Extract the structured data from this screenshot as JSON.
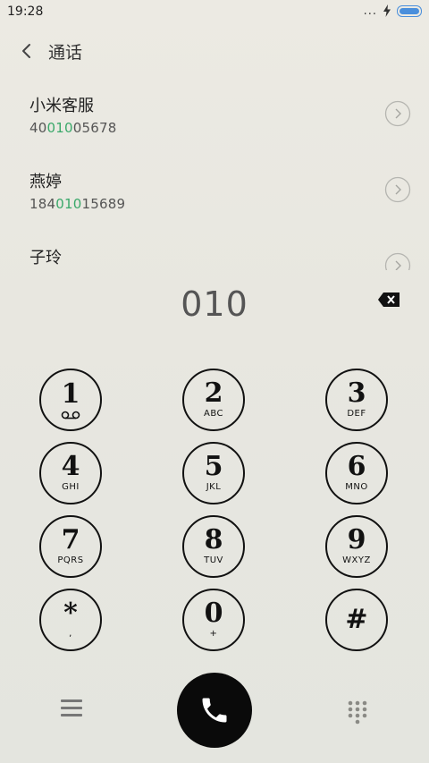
{
  "status": {
    "time": "19:28",
    "more_dots": "...",
    "colors": {
      "battery": "#4a8fdc"
    }
  },
  "header": {
    "title": "通话"
  },
  "contacts": [
    {
      "name": "小米客服",
      "number_pre": "40",
      "number_hl": "010",
      "number_post": "05678"
    },
    {
      "name": "燕婷",
      "number_pre": "184",
      "number_hl": "010",
      "number_post": "15689"
    },
    {
      "name": "子玲",
      "number_pre": "",
      "number_hl": "",
      "number_post": ""
    }
  ],
  "dialer": {
    "display": "010"
  },
  "keys": [
    {
      "digit": "1",
      "letters": "",
      "icon": "voicemail-icon"
    },
    {
      "digit": "2",
      "letters": "ABC"
    },
    {
      "digit": "3",
      "letters": "DEF"
    },
    {
      "digit": "4",
      "letters": "GHI"
    },
    {
      "digit": "5",
      "letters": "JKL"
    },
    {
      "digit": "6",
      "letters": "MNO"
    },
    {
      "digit": "7",
      "letters": "PQRS"
    },
    {
      "digit": "8",
      "letters": "TUV"
    },
    {
      "digit": "9",
      "letters": "WXYZ"
    },
    {
      "digit": "*",
      "letters": ","
    },
    {
      "digit": "0",
      "letters": "+"
    },
    {
      "digit": "#",
      "letters": ""
    }
  ],
  "colors": {
    "highlight": "#3aa86a",
    "call_button": "#0a0a0a"
  }
}
